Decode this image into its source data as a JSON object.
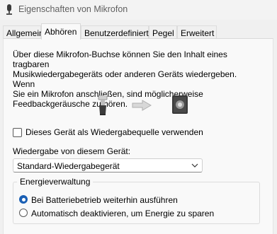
{
  "window": {
    "title": "Eigenschaften von Mikrofon"
  },
  "tabs": [
    {
      "label": "Allgemein",
      "active": false
    },
    {
      "label": "Abhören",
      "active": true
    },
    {
      "label": "Benutzerdefiniert",
      "active": false
    },
    {
      "label": "Pegel",
      "active": false
    },
    {
      "label": "Erweitert",
      "active": false
    }
  ],
  "listen": {
    "description": "Über diese Mikrofon-Buchse können Sie den Inhalt eines tragbaren\nMusikwiedergabegeräts oder anderen Geräts wiedergeben. Wenn\nSie ein Mikrofon anschließen, sind möglicherweise\nFeedbackgeräusche zu hören.",
    "checkbox_label": "Dieses Gerät als Wiedergabequelle verwenden",
    "checkbox_checked": false,
    "playback_label": "Wiedergabe von diesem Gerät:",
    "playback_device": "Standard-Wiedergabegerät"
  },
  "power": {
    "legend": "Energieverwaltung",
    "options": [
      {
        "label": "Bei Batteriebetrieb weiterhin ausführen",
        "selected": true
      },
      {
        "label": "Automatisch deaktivieren, um Energie zu sparen",
        "selected": false
      }
    ]
  },
  "colors": {
    "accent": "#1a5fb4",
    "panel": "#f9f9f9",
    "window": "#f0f0f0"
  },
  "icons": [
    "microphone-icon",
    "microphone-device-icon",
    "arrow-right-icon",
    "speaker-device-icon",
    "chevron-down-icon"
  ]
}
